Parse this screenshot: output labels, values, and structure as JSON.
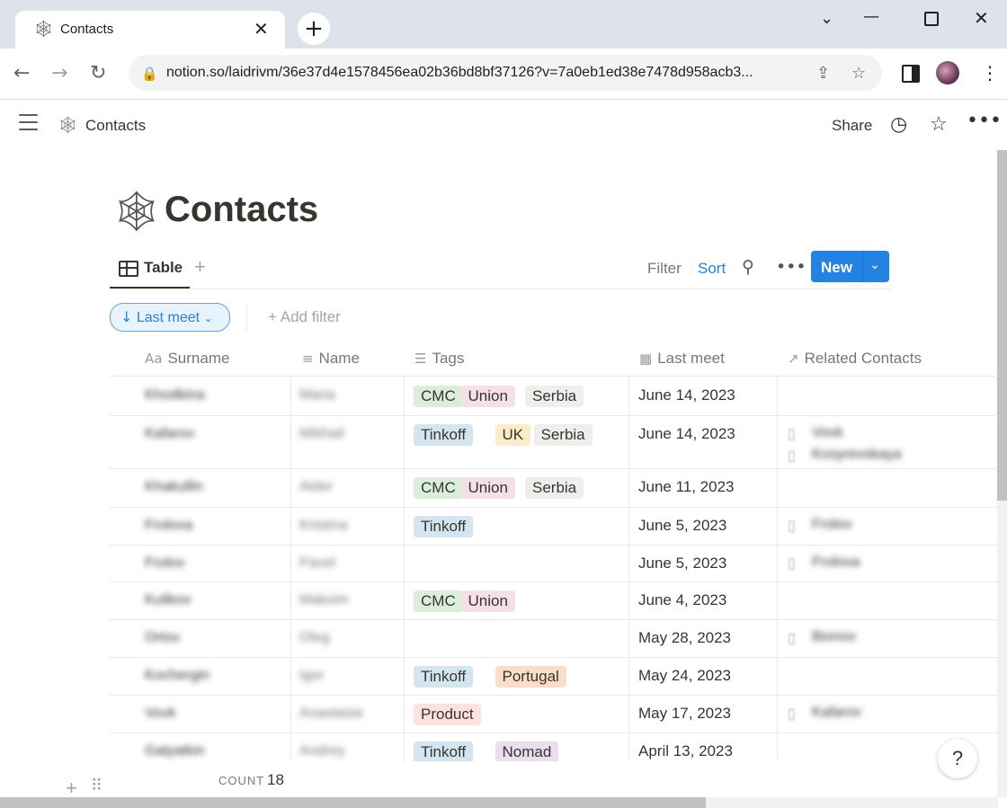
{
  "browser": {
    "tab_title": "Contacts",
    "tab_close": "✕",
    "new_tab": "+",
    "url": "notion.so/laidrivm/36e37d4e1578456ea02b36bd8bf37126?v=7a0eb1ed38e7478d958acb3...",
    "icons": [
      "back-icon",
      "forward-icon",
      "reload-icon",
      "lock-icon",
      "share-icon",
      "star-icon",
      "sidepanel-icon",
      "profile-avatar",
      "menu-icon"
    ]
  },
  "topbar": {
    "breadcrumb": "Contacts",
    "share": "Share",
    "icons": [
      "hamburger-icon",
      "clock-icon",
      "star-icon",
      "more-icon"
    ]
  },
  "page": {
    "title": "Contacts",
    "icon": "spiderweb-icon"
  },
  "view": {
    "tab": "Table",
    "filter": "Filter",
    "sort": "Sort",
    "new": "New",
    "pill": "Last meet",
    "add_filter": "Add filter"
  },
  "columns": [
    "Surname",
    "Name",
    "Tags",
    "Last meet",
    "Related Contacts"
  ],
  "tag_colors": {
    "CMC": "#dbeddb",
    "Union": "#f5e0e9",
    "Serbia": "#eeeeed",
    "Tinkoff": "#d3e5ef",
    "UK": "#fdecc8",
    "Portugal": "#fadec9",
    "Product": "#ffe2dd",
    "Nomad": "#e8deee"
  },
  "rows": [
    {
      "surname": "Khodkina",
      "name": "Maria",
      "tags": [
        "CMC",
        "Union",
        "Serbia"
      ],
      "last_meet": "June 14, 2023",
      "related": []
    },
    {
      "surname": "Kafarov",
      "name": "Mikhail",
      "tags": [
        "Tinkoff",
        "UK",
        "Serbia"
      ],
      "last_meet": "June 14, 2023",
      "related": [
        "Vovk",
        "Kosyrevskaya"
      ]
    },
    {
      "surname": "Khakullin",
      "name": "Aider",
      "tags": [
        "CMC",
        "Union",
        "Serbia"
      ],
      "last_meet": "June 11, 2023",
      "related": []
    },
    {
      "surname": "Frolova",
      "name": "Kristina",
      "tags": [
        "Tinkoff"
      ],
      "last_meet": "June 5, 2023",
      "related": [
        "Frolov"
      ]
    },
    {
      "surname": "Frolov",
      "name": "Pavel",
      "tags": [],
      "last_meet": "June 5, 2023",
      "related": [
        "Frolova"
      ]
    },
    {
      "surname": "Kulikov",
      "name": "Maksim",
      "tags": [
        "CMC",
        "Union"
      ],
      "last_meet": "June 4, 2023",
      "related": []
    },
    {
      "surname": "Ortov",
      "name": "Oleg",
      "tags": [],
      "last_meet": "May 28, 2023",
      "related": [
        "Bionov"
      ]
    },
    {
      "surname": "Kochergin",
      "name": "Igor",
      "tags": [
        "Tinkoff",
        "Portugal"
      ],
      "last_meet": "May 24, 2023",
      "related": []
    },
    {
      "surname": "Vovk",
      "name": "Anastasia",
      "tags": [
        "Product"
      ],
      "last_meet": "May 17, 2023",
      "related": [
        "Kafarov"
      ]
    },
    {
      "surname": "Galyatkin",
      "name": "Andrey",
      "tags": [
        "Tinkoff",
        "Nomad"
      ],
      "last_meet": "April 13, 2023",
      "related": []
    }
  ],
  "footer": {
    "count_label": "COUNT",
    "count_value": "18",
    "help": "?"
  }
}
